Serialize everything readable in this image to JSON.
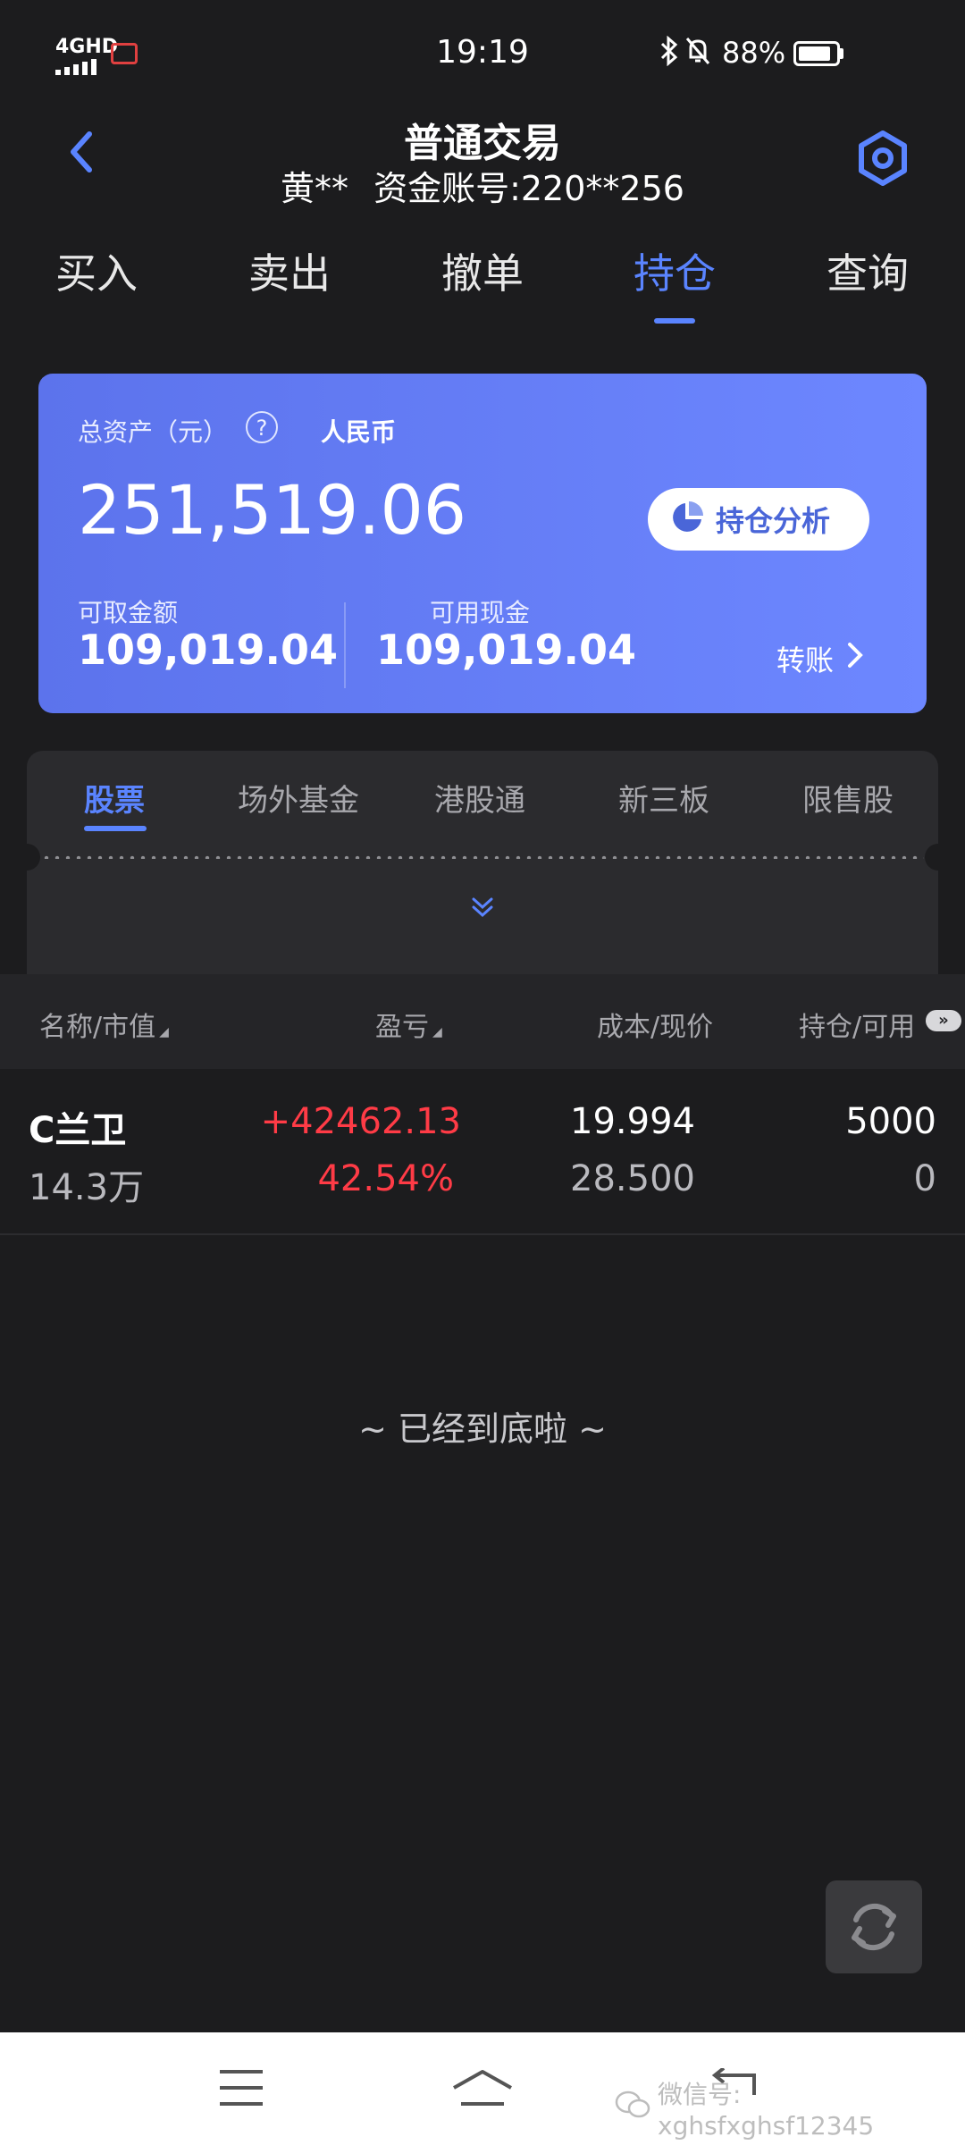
{
  "status_bar": {
    "network": "4GHD",
    "time": "19:19",
    "battery": "88%",
    "battery_level": 0.88
  },
  "header": {
    "title": "普通交易",
    "account_name": "黄**",
    "account_number": "资金账号:220**256"
  },
  "tabs": [
    {
      "label": "买入",
      "active": false
    },
    {
      "label": "卖出",
      "active": false
    },
    {
      "label": "撤单",
      "active": false
    },
    {
      "label": "持仓",
      "active": true
    },
    {
      "label": "查询",
      "active": false
    }
  ],
  "summary": {
    "total_label": "总资产（元）",
    "help": "?",
    "currency": "人民币",
    "total_value": "251,519.06",
    "analysis_button": "持仓分析",
    "withdrawable_label": "可取金额",
    "withdrawable_value": "109,019.04",
    "available_label": "可用现金",
    "available_value": "109,019.04",
    "transfer_label": "转账"
  },
  "categories": [
    {
      "label": "股票",
      "active": true
    },
    {
      "label": "场外基金",
      "active": false
    },
    {
      "label": "港股通",
      "active": false
    },
    {
      "label": "新三板",
      "active": false
    },
    {
      "label": "限售股",
      "active": false
    }
  ],
  "table": {
    "headers": {
      "name": "名称/市值",
      "pnl": "盈亏",
      "cost": "成本/现价",
      "position": "持仓/可用"
    },
    "rows": [
      {
        "name": "C兰卫",
        "market_value": "14.3万",
        "pnl": "+42462.13",
        "pnl_pct": "42.54%",
        "cost": "19.994",
        "price": "28.500",
        "position": "5000",
        "available": "0"
      }
    ],
    "end_text": "~ 已经到底啦 ~"
  },
  "watermark": "微信号: xghsfxghsf12345",
  "colors": {
    "accent": "#5a84ff",
    "card_start": "#5c73ec",
    "card_end": "#6d87ff",
    "profit": "#ff3b46",
    "background": "#1c1c1e"
  },
  "icons": [
    "back-arrow-icon",
    "settings-hexagon-icon",
    "help-icon",
    "pie-chart-icon",
    "chevron-right-icon",
    "expand-chevron-icon",
    "sort-icon",
    "more-columns-icon",
    "refresh-icon",
    "menu-icon",
    "home-icon",
    "back-icon",
    "wechat-icon"
  ]
}
